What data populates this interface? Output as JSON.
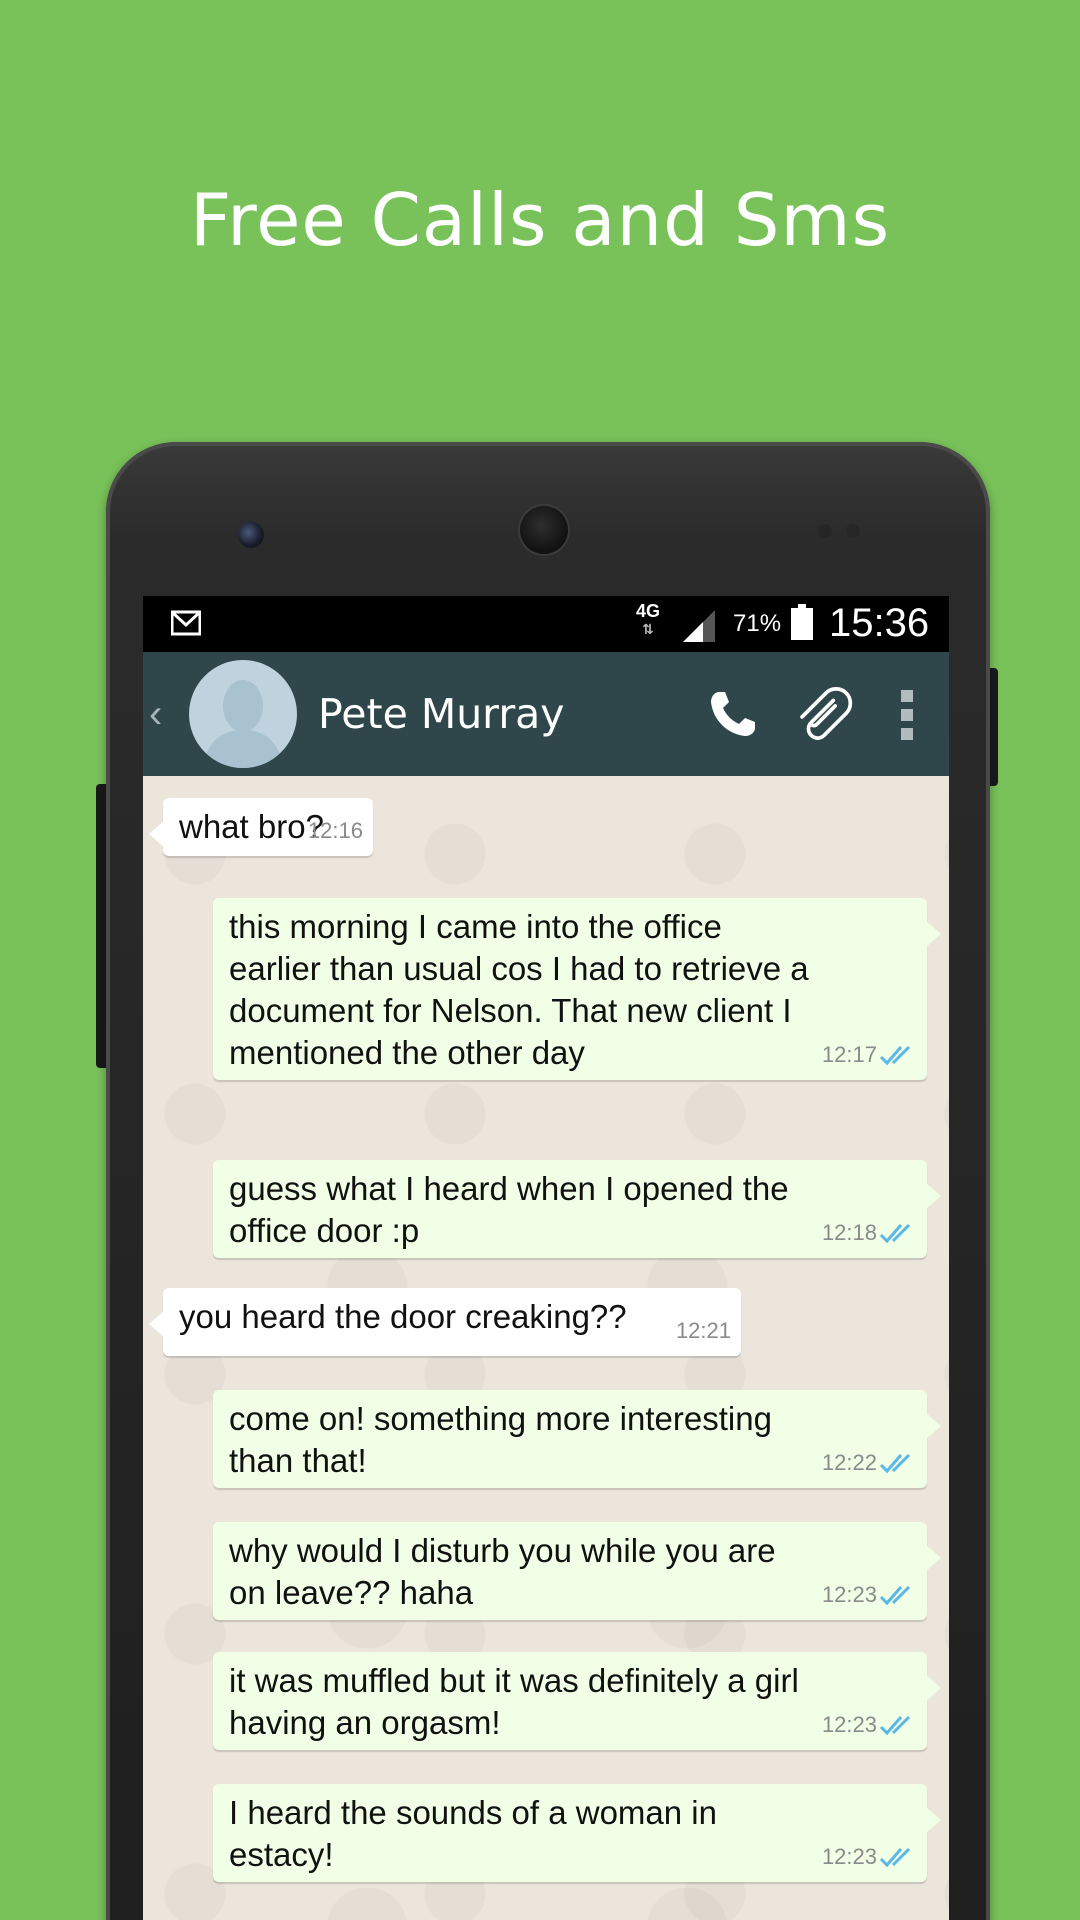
{
  "headline": "Free Calls and Sms",
  "status_bar": {
    "network": "4G",
    "battery": "71%",
    "time": "15:36"
  },
  "app_bar": {
    "contact_name": "Pete Murray"
  },
  "messages": [
    {
      "dir": "in",
      "text": "what bro?",
      "time": "12:16"
    },
    {
      "dir": "out",
      "text": "this morning I came into the office earlier than usual cos I had to retrieve a document for Nelson. That new client I mentioned the other day",
      "time": "12:17"
    },
    {
      "dir": "out",
      "text": "guess what I heard when I opened the office door :p",
      "time": "12:18"
    },
    {
      "dir": "in",
      "text": "you heard the door creaking??",
      "time": "12:21"
    },
    {
      "dir": "out",
      "text": "come on! something more interesting than that!",
      "time": "12:22"
    },
    {
      "dir": "out",
      "text": "why would I disturb you while you are on leave?? haha",
      "time": "12:23"
    },
    {
      "dir": "out",
      "text": "it was muffled but it was definitely a girl having an orgasm!",
      "time": "12:23"
    },
    {
      "dir": "out",
      "text": "I heard the sounds of a woman in estacy!",
      "time": "12:23"
    }
  ],
  "colors": {
    "background": "#79c25a",
    "app_bar": "#2f474b",
    "outgoing_bubble": "#f0ffe6",
    "incoming_bubble": "#ffffff",
    "read_tick": "#5ab7e6"
  }
}
